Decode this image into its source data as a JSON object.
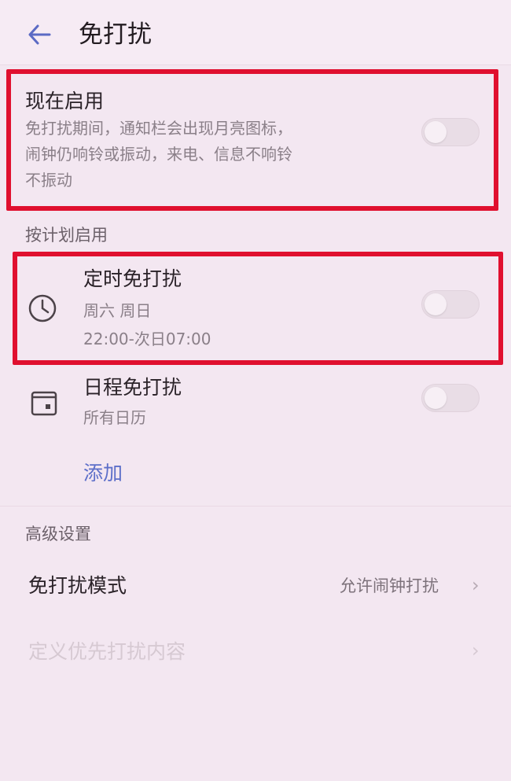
{
  "header": {
    "title": "免打扰"
  },
  "now": {
    "title": "现在启用",
    "desc_lines": [
      "免打扰期间，通知栏会出现月亮图标，",
      "闹钟仍响铃或振动，来电、信息不响铃",
      "不振动"
    ],
    "enabled": false
  },
  "plan": {
    "section_title": "按计划启用",
    "timed": {
      "title": "定时免打扰",
      "days": "周六 周日",
      "time": "22:00-次日07:00",
      "enabled": false
    },
    "calendar": {
      "title": "日程免打扰",
      "sub": "所有日历",
      "enabled": false
    },
    "add_label": "添加"
  },
  "advanced": {
    "section_title": "高级设置",
    "mode": {
      "title": "免打扰模式",
      "value": "允许闹钟打扰"
    },
    "custom": {
      "title": "定义优先打扰内容"
    }
  },
  "icons": {
    "back": "back-arrow-icon",
    "clock": "clock-icon",
    "calendar": "calendar-icon",
    "chevron": "chevron-right-icon"
  },
  "colors": {
    "highlight": "#e0102f",
    "accent": "#5d6fc9",
    "background": "#f3e7f1"
  }
}
